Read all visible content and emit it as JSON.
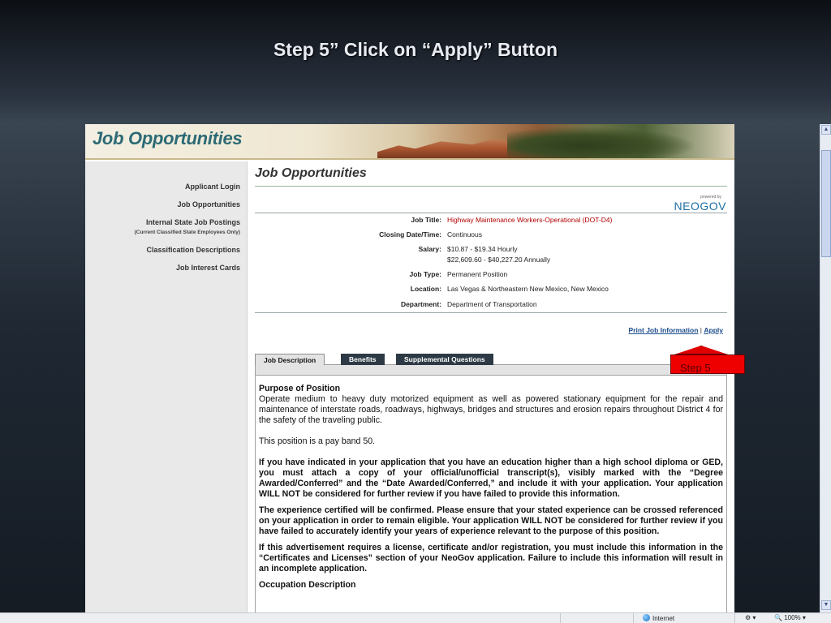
{
  "slide": {
    "title": "Step 5” Click on “Apply” Button"
  },
  "banner": {
    "title": "Job Opportunities"
  },
  "sidebar": {
    "items": [
      {
        "label": "Applicant Login"
      },
      {
        "label": "Job Opportunities"
      },
      {
        "label": "Internal State Job Postings",
        "sub": "(Current Classified State Employees Only)"
      },
      {
        "label": "Classification Descriptions"
      },
      {
        "label": "Job Interest Cards"
      }
    ]
  },
  "main": {
    "heading": "Job Opportunities",
    "powered_by": "powered by",
    "brand": "NEOGOV",
    "job": {
      "title_label": "Job Title:",
      "title_value": "Highway Maintenance Workers-Operational (DOT-D4)",
      "closing_label": "Closing Date/Time:",
      "closing_value": "Continuous",
      "salary_label": "Salary:",
      "salary_hourly": "$10.87 - $19.34 Hourly",
      "salary_annual": "$22,609.60 - $40,227.20 Annually",
      "type_label": "Job Type:",
      "type_value": "Permanent Position",
      "location_label": "Location:",
      "location_value": "Las Vegas & Northeastern New Mexico, New Mexico",
      "department_label": "Department:",
      "department_value": "Department of Transportation"
    },
    "links": {
      "print": "Print Job Information",
      "separator": " | ",
      "apply": "Apply"
    },
    "tabs": [
      {
        "label": "Job Description",
        "active": true
      },
      {
        "label": "Benefits",
        "active": false
      },
      {
        "label": "Supplemental Questions",
        "active": false
      }
    ],
    "content": {
      "purpose_heading": "Purpose of Position",
      "purpose_text": "Operate medium to heavy duty motorized equipment as well as powered stationary equipment for the repair and maintenance of interstate roads, roadways, highways, bridges and structures and erosion repairs throughout District 4 for the safety of the traveling public.",
      "pay_band": "This position is a pay band 50.",
      "education_notice": "If you have indicated in your application that you have an education higher than a high school diploma or GED, you must attach a copy of your official/unofficial transcript(s), visibly marked with the “Degree Awarded/Conferred” and the “Date Awarded/Conferred,” and include it with your application.  Your application WILL NOT be considered for further review if you have failed to provide this information.",
      "experience_notice": "The experience certified will be confirmed. Please ensure that your stated experience can be crossed referenced on your application in order to remain eligible. Your application WILL NOT be considered for further review if you have failed to accurately identify your years of experience relevant to the purpose of this position.",
      "license_notice": "If this advertisement requires a license, certificate and/or registration, you must include this information in the “Certificates and Licenses” section of your NeoGov application.  Failure to include this information will result in an incomplete application.",
      "occupation_heading": "Occupation Description"
    }
  },
  "callout": {
    "label": "Step 5",
    "color": "#ee0000"
  },
  "statusbar": {
    "zone": "Internet",
    "zoom": "100%"
  }
}
